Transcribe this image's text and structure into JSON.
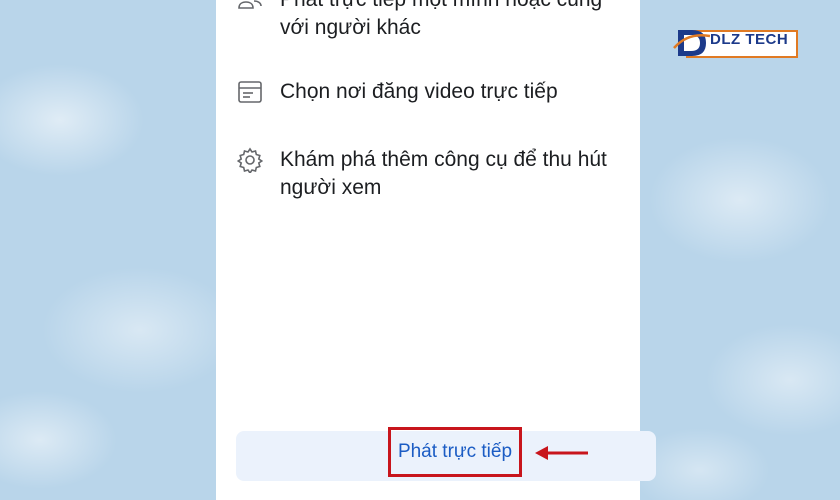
{
  "menu": {
    "items": [
      {
        "icon": "users-icon",
        "label": "Phát trực tiếp một mình hoặc cùng với người khác"
      },
      {
        "icon": "browser-window-icon",
        "label": "Chọn nơi đăng video trực tiếp"
      },
      {
        "icon": "gear-icon",
        "label": "Khám phá thêm công cụ để thu hút người xem"
      }
    ]
  },
  "cta": {
    "label": "Phát trực tiếp"
  },
  "colors": {
    "background": "#b9d5ea",
    "cta_bar": "#ebf2fc",
    "cta_text": "#1b5cc4",
    "highlight": "#c8151c",
    "logo_orange": "#e07a23",
    "logo_blue": "#1c3a8a"
  },
  "logo": {
    "name": "DLZ TECH"
  }
}
